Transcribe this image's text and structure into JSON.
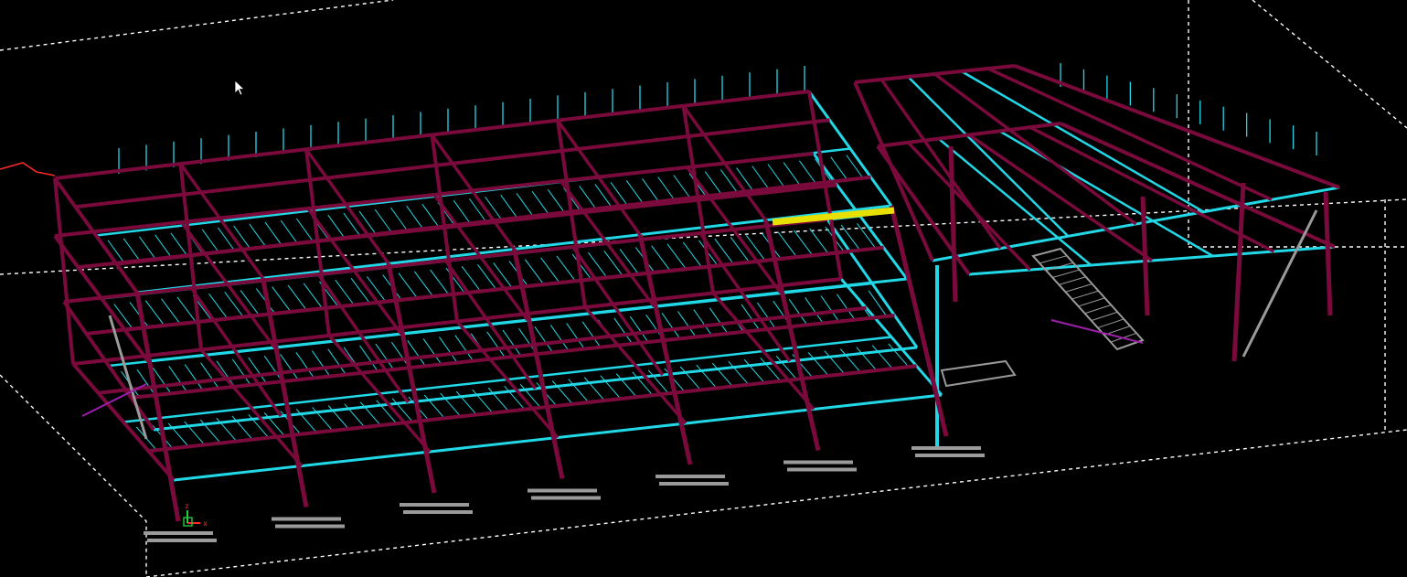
{
  "viewport": {
    "background": "#000000",
    "colors": {
      "bounding_box": "#ffffff",
      "primary_steel": "#7a0a3c",
      "secondary_steel": "#22d8e6",
      "selected_member": "#e8e000",
      "stair_grating": "#9a9a9a",
      "handrail": "#9b1fa8",
      "axis_x": "#ff2a2a",
      "axis_y": "#22c93a",
      "axis_z": "#ff2a2a"
    }
  },
  "axis_gizmo": {
    "x_label": "x",
    "z_label": "z"
  },
  "cursor": {
    "icon": "mouse-pointer-arrow"
  }
}
